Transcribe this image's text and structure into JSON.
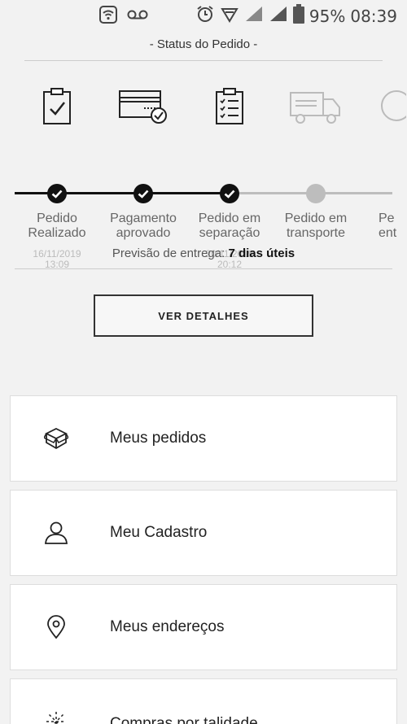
{
  "statusbar": {
    "battery": "95%",
    "time": "08:39",
    "icons": [
      "wifi-icon",
      "voicemail-icon",
      "alarm-icon",
      "signal-icon",
      "battery-icon"
    ]
  },
  "order_status": {
    "title": "- Status do Pedido -",
    "steps": [
      {
        "label_line1": "Pedido",
        "label_line2": "Realizado",
        "date": "16/11/2019",
        "time": "13:09",
        "icon": "clipboard-check-icon",
        "done": true
      },
      {
        "label_line1": "Pagamento",
        "label_line2": "aprovado",
        "date": "",
        "time": "",
        "icon": "credit-card-check-icon",
        "done": true
      },
      {
        "label_line1": "Pedido em",
        "label_line2": "separação",
        "date": "20/11/2019",
        "time": "20:12",
        "icon": "checklist-icon",
        "done": true
      },
      {
        "label_line1": "Pedido em",
        "label_line2": "transporte",
        "date": "",
        "time": "",
        "icon": "truck-icon",
        "done": false
      },
      {
        "label_line1": "Pe",
        "label_line2": "ent",
        "date": "",
        "time": "",
        "icon": "delivered-icon",
        "done": false
      }
    ],
    "delivery_prefix": "Previsão de entrega:",
    "delivery_value": "7 dias úteis",
    "details_button": "VER DETALHES"
  },
  "menu": {
    "items": [
      {
        "label": "Meus pedidos",
        "icon": "box-icon"
      },
      {
        "label": "Meu Cadastro",
        "icon": "user-icon"
      },
      {
        "label": "Meus endereços",
        "icon": "location-pin-icon"
      },
      {
        "label": "Compras por talidade",
        "icon": "sparkle-icon"
      }
    ]
  },
  "colors": {
    "done": "#111111",
    "todo": "#bdbdbd",
    "background": "#f2f2f2"
  }
}
